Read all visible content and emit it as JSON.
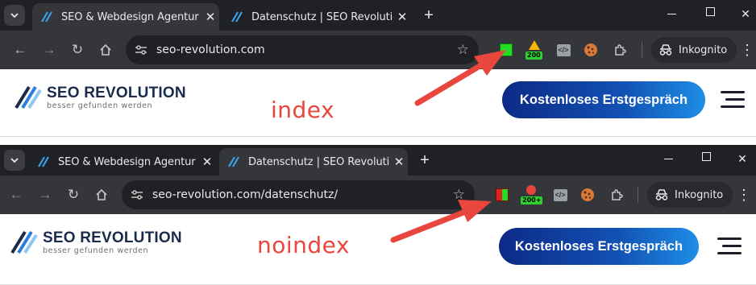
{
  "screens": [
    {
      "tabs": [
        {
          "title": "SEO & Webdesign Agentur Berl",
          "active": true
        },
        {
          "title": "Datenschutz | SEO Revolution",
          "active": false
        }
      ],
      "url": "seo-revolution.com",
      "status_badge": "200",
      "incognito_label": "Inkognito",
      "logo": {
        "name": "SEO REVOLUTION",
        "slogan": "besser gefunden werden"
      },
      "annotation": "index",
      "cta_label": "Kostenloses Erstgespräch"
    },
    {
      "tabs": [
        {
          "title": "SEO & Webdesign Agentur Berl",
          "active": false
        },
        {
          "title": "Datenschutz | SEO Revolution",
          "active": true
        }
      ],
      "url": "seo-revolution.com/datenschutz/",
      "status_badge": "200+",
      "incognito_label": "Inkognito",
      "logo": {
        "name": "SEO REVOLUTION",
        "slogan": "besser gefunden werden"
      },
      "annotation": "noindex",
      "cta_label": "Kostenloses Erstgespräch"
    }
  ],
  "colors": {
    "tabstrip": "#202124",
    "toolbar": "#35363a",
    "robots_index": "#22dd22",
    "robots_noindex": "#dd2222",
    "annotation": "#e9463d",
    "cta_start": "#0d2a86",
    "cta_end": "#1e8ee6",
    "brand_text": "#1a2b4c"
  },
  "icons": [
    "tab-search-icon",
    "seo-revolution-favicon",
    "close-icon",
    "new-tab-icon",
    "window-minimize-icon",
    "window-maximize-icon",
    "window-close-icon",
    "back-icon",
    "forward-icon",
    "reload-icon",
    "home-icon",
    "site-info-icon",
    "bookmark-star-icon",
    "robots-status-icon",
    "http-status-icon",
    "source-code-icon",
    "cookie-icon",
    "extensions-puzzle-icon",
    "incognito-icon",
    "kebab-menu-icon",
    "logo-slashes-icon",
    "hamburger-menu-icon",
    "red-arrow"
  ]
}
